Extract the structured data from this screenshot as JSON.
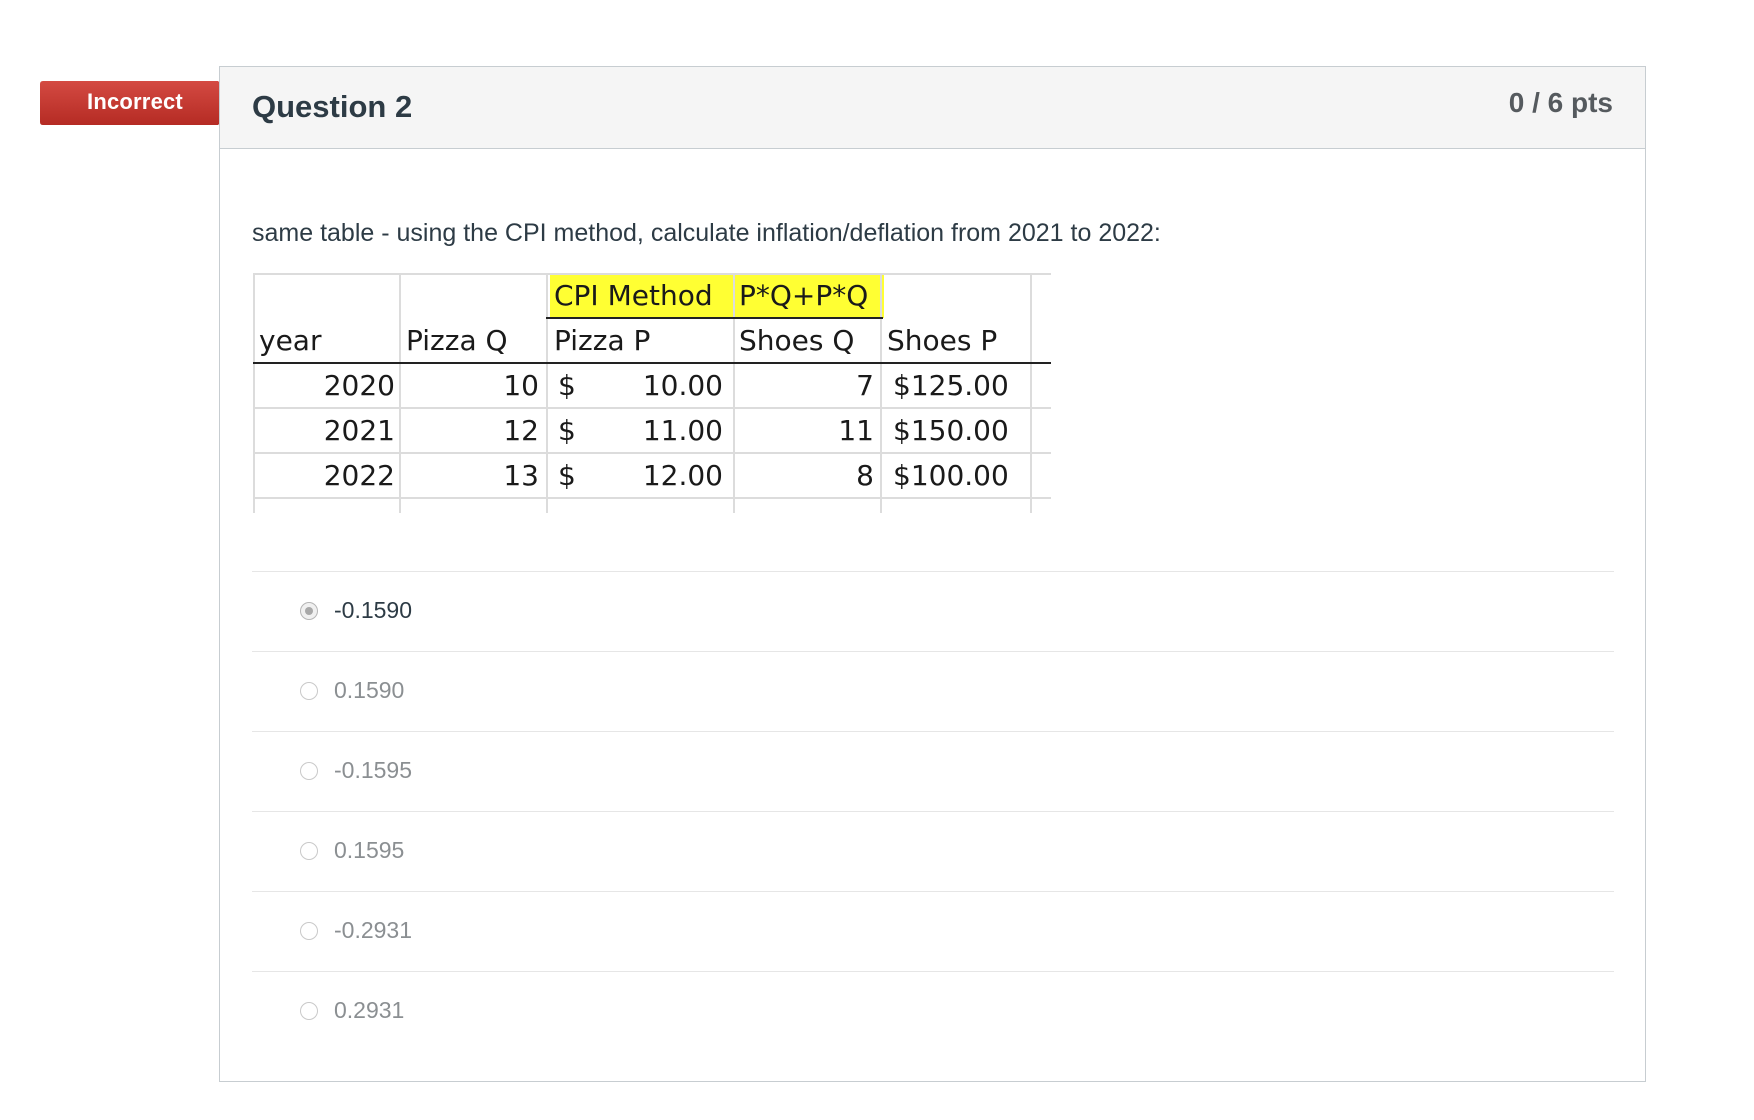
{
  "status_flag": "Incorrect",
  "question": {
    "title": "Question 2",
    "points": "0 / 6 pts",
    "prompt": "same table - using the CPI method, calculate inflation/deflation from 2021 to 2022:"
  },
  "table": {
    "banner": [
      "CPI Method",
      "P*Q+P*Q"
    ],
    "headers": [
      "year",
      "Pizza Q",
      "Pizza P",
      "Shoes Q",
      "Shoes P"
    ],
    "rows": [
      {
        "year": "2020",
        "pizza_q": "10",
        "pizza_p_sym": "$",
        "pizza_p": "10.00",
        "shoes_q": "7",
        "shoes_p": "$125.00"
      },
      {
        "year": "2021",
        "pizza_q": "12",
        "pizza_p_sym": "$",
        "pizza_p": "11.00",
        "shoes_q": "11",
        "shoes_p": "$150.00"
      },
      {
        "year": "2022",
        "pizza_q": "13",
        "pizza_p_sym": "$",
        "pizza_p": "12.00",
        "shoes_q": "8",
        "shoes_p": "$100.00"
      }
    ],
    "highlight_color": "#ffff33"
  },
  "answers": [
    {
      "label": "-0.1590",
      "selected": true
    },
    {
      "label": "0.1590",
      "selected": false
    },
    {
      "label": "-0.1595",
      "selected": false
    },
    {
      "label": "0.1595",
      "selected": false
    },
    {
      "label": "-0.2931",
      "selected": false
    },
    {
      "label": "0.2931",
      "selected": false
    }
  ],
  "colors": {
    "incorrect_red": "#c9302c",
    "header_bg": "#f5f5f5",
    "text": "#2d3b45"
  }
}
